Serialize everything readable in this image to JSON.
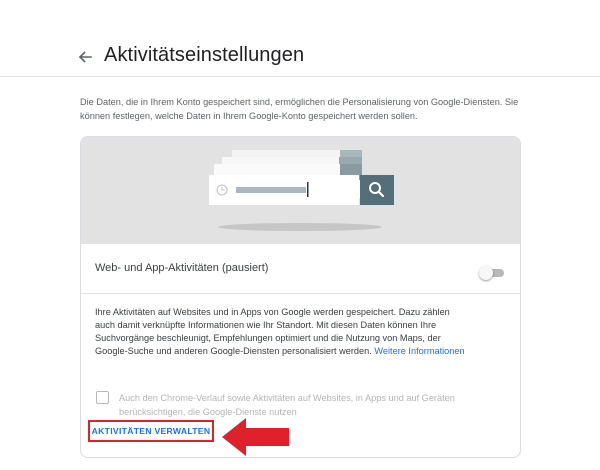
{
  "header": {
    "back_icon": "arrow-back-icon",
    "title": "Aktivitätseinstellungen"
  },
  "intro": "Die Daten, die in Ihrem Konto gespeichert sind, ermöglichen die Personalisierung von Google-Diensten. Sie können festlegen, welche Daten in Ihrem Google-Konto gespeichert werden sollen.",
  "card": {
    "illustration_icons": [
      "history-icon",
      "search-icon"
    ],
    "toggle_label": "Web- und App-Aktivitäten (pausiert)",
    "toggle_on": false,
    "description": "Ihre Aktivitäten auf Websites und in Apps von Google werden gespeichert. Dazu zählen auch damit verknüpfte Informationen wie Ihr Standort. Mit diesen Daten können Ihre Suchvorgänge beschleunigt, Empfehlungen optimiert und die Nutzung von Maps, der Google-Suche und anderen Google-Diensten personalisiert werden.",
    "more_link": "Weitere Informationen",
    "checkbox_checked": false,
    "checkbox_label": "Auch den Chrome-Verlauf sowie Aktivitäten auf Websites, in Apps und auf Geräten berücksichtigen, die Google-Dienste nutzen",
    "manage_label": "AKTIVITÄTEN VERWALTEN"
  },
  "annotation": {
    "arrow_icon": "red-arrow-left-icon",
    "highlight_color": "#e0202a"
  },
  "colors": {
    "link": "#1a73e8",
    "illustration_bg": "#e2e2e2",
    "search_button": "#546e7a"
  }
}
